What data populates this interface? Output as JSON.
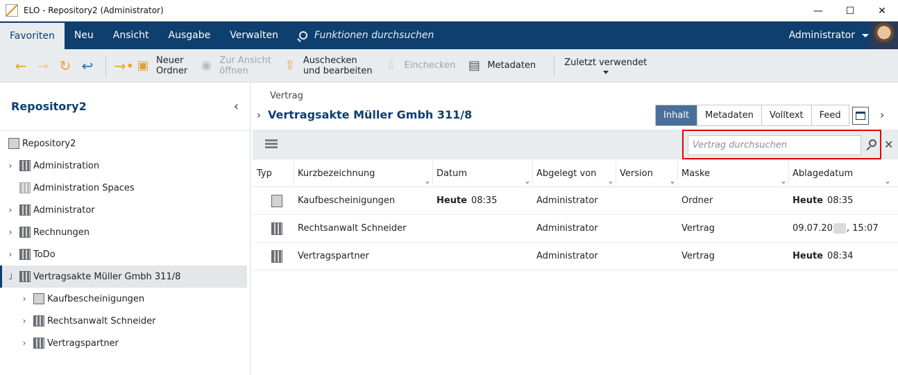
{
  "window": {
    "title": "ELO - Repository2 (Administrator)",
    "controls": [
      "—",
      "☐",
      "✕"
    ]
  },
  "menu": {
    "items": [
      "Favoriten",
      "Neu",
      "Ansicht",
      "Ausgabe",
      "Verwalten"
    ],
    "active": "Favoriten",
    "search_placeholder": "Funktionen durchsuchen",
    "user": "Administrator"
  },
  "toolbar": {
    "new_folder": "Neuer\nOrdner",
    "to_view": "Zur Ansicht\nöffnen",
    "checkout": "Auschecken\nund bearbeiten",
    "checkin": "Einchecken",
    "metadata": "Metadaten",
    "recent": "Zuletzt verwendet"
  },
  "sidebar": {
    "title": "Repository2",
    "items": [
      {
        "label": "Repository2",
        "indent": 0,
        "expand": ""
      },
      {
        "label": "Administration",
        "indent": 0,
        "expand": "›"
      },
      {
        "label": "Administration Spaces",
        "indent": 0,
        "expand": ""
      },
      {
        "label": "Administrator",
        "indent": 0,
        "expand": "›"
      },
      {
        "label": "Rechnungen",
        "indent": 0,
        "expand": "›"
      },
      {
        "label": "ToDo",
        "indent": 0,
        "expand": "›"
      },
      {
        "label": "Vertragsakte Müller Gmbh 311/8",
        "indent": 0,
        "expand": "˩",
        "selected": true
      },
      {
        "label": "Kaufbescheinigungen",
        "indent": 1,
        "expand": "›"
      },
      {
        "label": "Rechtsanwalt Schneider",
        "indent": 1,
        "expand": "›"
      },
      {
        "label": "Vertragspartner",
        "indent": 1,
        "expand": "›"
      }
    ]
  },
  "main": {
    "breadcrumb": "Vertrag",
    "title": "Vertragsakte Müller Gmbh 311/8",
    "tabs": [
      "Inhalt",
      "Metadaten",
      "Volltext",
      "Feed"
    ],
    "active_tab": "Inhalt",
    "search_placeholder": "Vertrag durchsuchen",
    "columns": [
      "Typ",
      "Kurzbezeichnung",
      "Datum",
      "Abgelegt von",
      "Version",
      "Maske",
      "Ablagedatum"
    ],
    "rows": [
      {
        "name": "Kaufbescheinigungen",
        "date_bold": "Heute",
        "date": "08:35",
        "filed_by": "Administrator",
        "version": "",
        "mask": "Ordner",
        "filed_bold": "Heute",
        "filed_date": "08:35",
        "icon": "folder-icon"
      },
      {
        "name": "Rechtsanwalt Schneider",
        "date_bold": "",
        "date": "",
        "filed_by": "Administrator",
        "version": "",
        "mask": "Vertrag",
        "filed_bold": "",
        "filed_date": "09.07.20",
        "filed_date_suffix": ", 15:07",
        "icon": "binder-icon"
      },
      {
        "name": "Vertragspartner",
        "date_bold": "",
        "date": "",
        "filed_by": "Administrator",
        "version": "",
        "mask": "Vertrag",
        "filed_bold": "Heute",
        "filed_date": "08:34",
        "icon": "binder-icon"
      }
    ]
  },
  "colors": {
    "brand": "#0e3f6e",
    "tab_active": "#4a6f9a",
    "highlight": "#e00000",
    "accent_orange": "#f0a030"
  }
}
